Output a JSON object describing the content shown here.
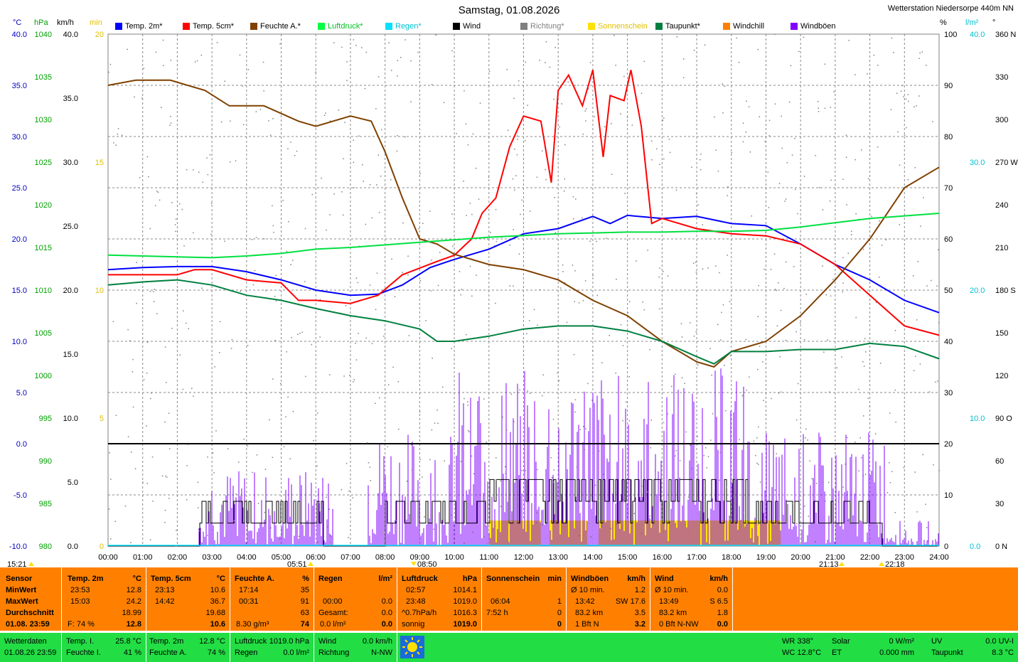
{
  "header": {
    "title": "Samstag, 01.08.2026",
    "station": "Wetterstation Niedersorpe 440m NN"
  },
  "units": {
    "temp": "°C",
    "pressure": "hPa",
    "wind": "km/h",
    "sun": "min",
    "humidity": "%",
    "rain": "l/m²",
    "direction": "°"
  },
  "legend": [
    {
      "label": "Temp. 2m*",
      "color": "#0000ff"
    },
    {
      "label": "Temp. 5cm*",
      "color": "#ff0000"
    },
    {
      "label": "Feuchte A.*",
      "color": "#804000"
    },
    {
      "label": "Luftdruck*",
      "color": "#00ff40"
    },
    {
      "label": "Regen*",
      "color": "#00e0ff"
    },
    {
      "label": "Wind",
      "color": "#000000"
    },
    {
      "label": "Richtung*",
      "color": "#808080"
    },
    {
      "label": "Sonnenschein",
      "color": "#ffe000"
    },
    {
      "label": "Taupunkt*",
      "color": "#008040"
    },
    {
      "label": "Windchill",
      "color": "#ff8000"
    },
    {
      "label": "Windböen",
      "color": "#8000ff"
    }
  ],
  "chart_data": {
    "type": "line",
    "x_ticks": [
      "00:00",
      "01:00",
      "02:00",
      "03:00",
      "04:00",
      "05:00",
      "06:00",
      "07:00",
      "08:00",
      "09:00",
      "10:00",
      "11:00",
      "12:00",
      "13:00",
      "14:00",
      "15:00",
      "16:00",
      "17:00",
      "18:00",
      "19:00",
      "20:00",
      "21:00",
      "22:00",
      "23:00",
      "24:00"
    ],
    "axes": {
      "temp": {
        "color": "#0000c0",
        "ticks": [
          "40.0",
          "35.0",
          "30.0",
          "25.0",
          "20.0",
          "15.0",
          "10.0",
          "5.0",
          "0.0",
          "-5.0",
          "-10.0"
        ],
        "range": [
          -10,
          40
        ]
      },
      "pressure": {
        "color": "#00a000",
        "ticks": [
          "1040",
          "1035",
          "1030",
          "1025",
          "1020",
          "1015",
          "1010",
          "1005",
          "1000",
          "995",
          "990",
          "985",
          "980"
        ],
        "range": [
          980,
          1040
        ]
      },
      "wind": {
        "color": "#000000",
        "ticks": [
          "40.0",
          "35.0",
          "30.0",
          "25.0",
          "20.0",
          "15.0",
          "10.0",
          "5.0",
          "0.0"
        ],
        "range": [
          0,
          40
        ]
      },
      "sun": {
        "color": "#e0c000",
        "ticks": [
          "20",
          "15",
          "10",
          "5",
          "0"
        ],
        "range": [
          0,
          20
        ]
      },
      "humidity": {
        "color": "#000000",
        "ticks": [
          "100",
          "90",
          "80",
          "70",
          "60",
          "50",
          "40",
          "30",
          "20",
          "10",
          "0"
        ],
        "range": [
          0,
          100
        ]
      },
      "rain": {
        "color": "#00c0d0",
        "ticks": [
          "40.0",
          "30.0",
          "20.0",
          "10.0",
          "0.0"
        ],
        "range": [
          0,
          40
        ]
      },
      "direction": {
        "color": "#000000",
        "ticks": [
          "360 N",
          "330",
          "300",
          "270 W",
          "240",
          "210",
          "180 S",
          "150",
          "120",
          "90 O",
          "60",
          "30",
          "0 N"
        ],
        "range": [
          0,
          360
        ]
      }
    },
    "series": [
      {
        "name": "Temp. 2m*",
        "axis": "temp",
        "color": "#0000ff",
        "x": [
          0,
          1,
          2,
          3,
          4,
          5,
          6,
          7,
          7.8,
          8.5,
          9.3,
          10,
          11,
          12,
          13,
          14,
          14.5,
          15,
          16,
          17,
          18,
          19,
          20,
          21,
          22,
          23,
          24
        ],
        "y": [
          17.0,
          17.2,
          17.3,
          17.3,
          16.8,
          16.0,
          15.0,
          14.5,
          14.6,
          15.5,
          17.2,
          18.0,
          19.0,
          20.5,
          21.0,
          22.2,
          21.5,
          22.3,
          22.0,
          22.2,
          21.5,
          21.3,
          19.5,
          17.5,
          16.0,
          14.0,
          12.8
        ]
      },
      {
        "name": "Temp. 5cm*",
        "axis": "temp",
        "color": "#ff0000",
        "x": [
          0,
          1,
          2,
          2.5,
          3,
          4,
          5,
          5.5,
          6,
          7,
          7.8,
          8.5,
          9.5,
          10,
          10.5,
          10.8,
          11.2,
          11.6,
          12,
          12.5,
          12.8,
          13,
          13.3,
          13.7,
          14,
          14.3,
          14.5,
          14.9,
          15.1,
          15.4,
          15.7,
          16,
          17,
          18,
          19,
          20,
          21,
          22,
          23,
          24
        ],
        "y": [
          16.5,
          16.5,
          16.5,
          17.0,
          17.0,
          16.0,
          15.7,
          14.0,
          14.0,
          13.7,
          14.5,
          16.5,
          17.8,
          18.4,
          20.0,
          22.5,
          24.0,
          29.0,
          32.0,
          31.5,
          25.5,
          34.5,
          36.0,
          33.0,
          36.5,
          28.0,
          34.0,
          33.5,
          36.5,
          31.0,
          21.5,
          22.0,
          21.0,
          20.5,
          20.3,
          19.5,
          17.5,
          14.5,
          11.5,
          10.6
        ]
      },
      {
        "name": "Feuchte A.*",
        "axis": "humidity",
        "color": "#804000",
        "x": [
          0,
          0.8,
          1.8,
          2.8,
          3.5,
          4.5,
          5.5,
          6,
          7,
          7.6,
          8,
          8.5,
          9,
          9.5,
          10,
          11,
          12,
          13,
          14,
          15,
          16,
          17,
          17.5,
          18,
          19,
          20,
          21,
          22,
          23,
          24
        ],
        "y": [
          90,
          91,
          91,
          89,
          86,
          86,
          83,
          82,
          84,
          83,
          77,
          68,
          60,
          59,
          57,
          55,
          54,
          52,
          48,
          45,
          40,
          36,
          35,
          38,
          40,
          45,
          52,
          60,
          70,
          74
        ]
      },
      {
        "name": "Luftdruck*",
        "axis": "pressure",
        "color": "#00e040",
        "x": [
          0,
          2,
          3,
          4,
          5,
          6,
          7,
          8,
          9,
          10,
          11,
          12,
          13,
          14,
          15,
          16,
          17,
          18,
          19,
          20,
          21,
          22,
          23,
          24
        ],
        "y": [
          1014.1,
          1013.9,
          1013.8,
          1014.0,
          1014.3,
          1014.8,
          1015.0,
          1015.3,
          1015.6,
          1015.9,
          1016.2,
          1016.4,
          1016.6,
          1016.7,
          1016.8,
          1016.8,
          1016.9,
          1016.9,
          1017.0,
          1017.4,
          1017.9,
          1018.4,
          1018.7,
          1019.0
        ]
      },
      {
        "name": "Taupunkt*",
        "axis": "temp",
        "color": "#008040",
        "x": [
          0,
          1,
          2,
          3,
          4,
          5,
          6,
          7,
          8,
          9,
          9.5,
          10,
          11,
          12,
          13,
          14,
          15,
          16,
          17,
          17.5,
          18,
          19,
          20,
          21,
          22,
          23,
          24
        ],
        "y": [
          15.5,
          15.8,
          16.0,
          15.5,
          14.5,
          14.0,
          13.2,
          12.5,
          12.0,
          11.2,
          10.0,
          10.0,
          10.5,
          11.2,
          11.5,
          11.5,
          11.0,
          10.0,
          8.5,
          7.8,
          9.0,
          9.0,
          9.2,
          9.2,
          9.8,
          9.5,
          8.3
        ]
      }
    ],
    "wind_mean_level": 0,
    "gust_peak": 36.5,
    "sunshine_blocks": [
      [
        "11:00",
        "12:30"
      ],
      [
        "12:45",
        "13:50"
      ],
      [
        "14:10",
        "19:25"
      ]
    ],
    "sunrise": "05:51",
    "sunset": "21:13",
    "moon_marks": [
      "15:21",
      "08:50",
      "22:18"
    ]
  },
  "table": {
    "rows": [
      "Sensor",
      "MinWert",
      "MaxWert",
      "Durchschnitt",
      "01.08. 23:59"
    ],
    "temp2m": {
      "head": "Temp. 2m",
      "unit": "°C",
      "min_t": "23:53",
      "min_v": "12.8",
      "max_t": "15:03",
      "max_v": "24.2",
      "avg": "18.99",
      "last_label": "F: 74 %",
      "last": "12.8"
    },
    "temp5cm": {
      "head": "Temp. 5cm",
      "unit": "°C",
      "min_t": "23:13",
      "min_v": "10.6",
      "max_t": "14:42",
      "max_v": "36.7",
      "avg": "19.68",
      "last": "10.6"
    },
    "feuchte": {
      "head": "Feuchte A.",
      "unit": "%",
      "min_t": "17:14",
      "min_v": "35",
      "max_t": "00:31",
      "max_v": "91",
      "avg": "63",
      "last_label": "8.30 g/m³",
      "last": "74"
    },
    "regen": {
      "head": "Regen",
      "unit": "l/m²",
      "r1_t": "00:00",
      "r1_v": "0.0",
      "r2_t": "Gesamt:",
      "r2_v": "0.0",
      "r3_t": "0.0 l/m²",
      "r3_v": "0.0"
    },
    "luftdruck": {
      "head": "Luftdruck",
      "unit": "hPa",
      "min_t": "02:57",
      "min_v": "1014.1",
      "max_t": "23:48",
      "max_v": "1019.0",
      "avg_t": "^0.7hPa/h",
      "avg": "1016.3",
      "last_label": "sonnig",
      "last": "1019.0"
    },
    "sonne": {
      "head": "Sonnenschein",
      "unit": "min",
      "r1_t": "06:04",
      "r1_v": "1",
      "r2_t": "7:52 h",
      "r2_v": "0",
      "r3_v": "0"
    },
    "windboeen": {
      "head": "Windböen",
      "unit": "km/h",
      "r1_t": "Ø 10 min.",
      "r1_v": "1.2",
      "r2_t": "13:42",
      "r2_m": "SW 17.6",
      "r3_t": "83.2 km",
      "r3_v": "3.5",
      "r4_t": "1 Bft N",
      "r4_v": "3.2"
    },
    "wind": {
      "head": "Wind",
      "unit": "km/h",
      "r1_t": "Ø 10 min.",
      "r1_v": "0.0",
      "r2_t": "13:49",
      "r2_m": "S 6.5",
      "r3_t": "83.2 km",
      "r3_v": "1.8",
      "r4_t": "0 Bft N-NW",
      "r4_v": "0.0"
    }
  },
  "bottom": {
    "wd_label": "Wetterdaten",
    "wd_time": "01.08.26 23:59",
    "temp_i_label": "Temp. I.",
    "temp_i": "25.8 °C",
    "feuchte_i_label": "Feuchte I.",
    "feuchte_i": "41 %",
    "temp2m_label": "Temp. 2m",
    "temp2m": "12.8 °C",
    "feuchte_a_label": "Feuchte A.",
    "feuchte_a": "74 %",
    "luftdruck_label": "Luftdruck",
    "luftdruck": "1019.0 hPa",
    "regen_label": "Regen",
    "regen": "0.0 l/m²",
    "wind_label": "Wind",
    "wind": "0.0 km/h",
    "richtung_label": "Richtung",
    "richtung": "N-NW",
    "wr": "WR 338°",
    "wc": "WC 12.8°C",
    "solar_label": "Solar",
    "solar": "0 W/m²",
    "et_label": "ET",
    "et": "0.000 mm",
    "uv_label": "UV",
    "uv": "0.0 UV-I",
    "taupunkt_label": "Taupunkt",
    "taupunkt": "8.3 °C"
  }
}
